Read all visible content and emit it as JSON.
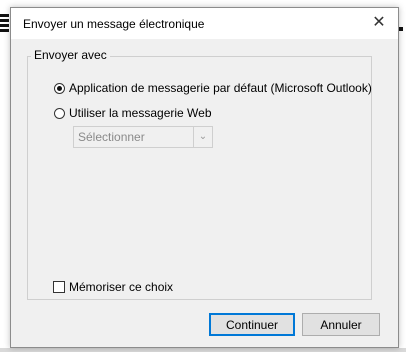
{
  "dialog": {
    "title": "Envoyer un message électronique",
    "close_glyph": "✕"
  },
  "group": {
    "legend": "Envoyer avec",
    "option_default": "Application de messagerie par défaut (Microsoft Outlook)",
    "option_web": "Utiliser la messagerie Web",
    "select_value": "Sélectionner",
    "remember_label": "Mémoriser ce choix"
  },
  "state": {
    "selected_option": "default",
    "remember_checked": false
  },
  "buttons": {
    "continue_label": "Continuer",
    "cancel_label": "Annuler"
  },
  "colors": {
    "accent": "#0078d7",
    "dialog_bg": "#f0f0f0"
  }
}
